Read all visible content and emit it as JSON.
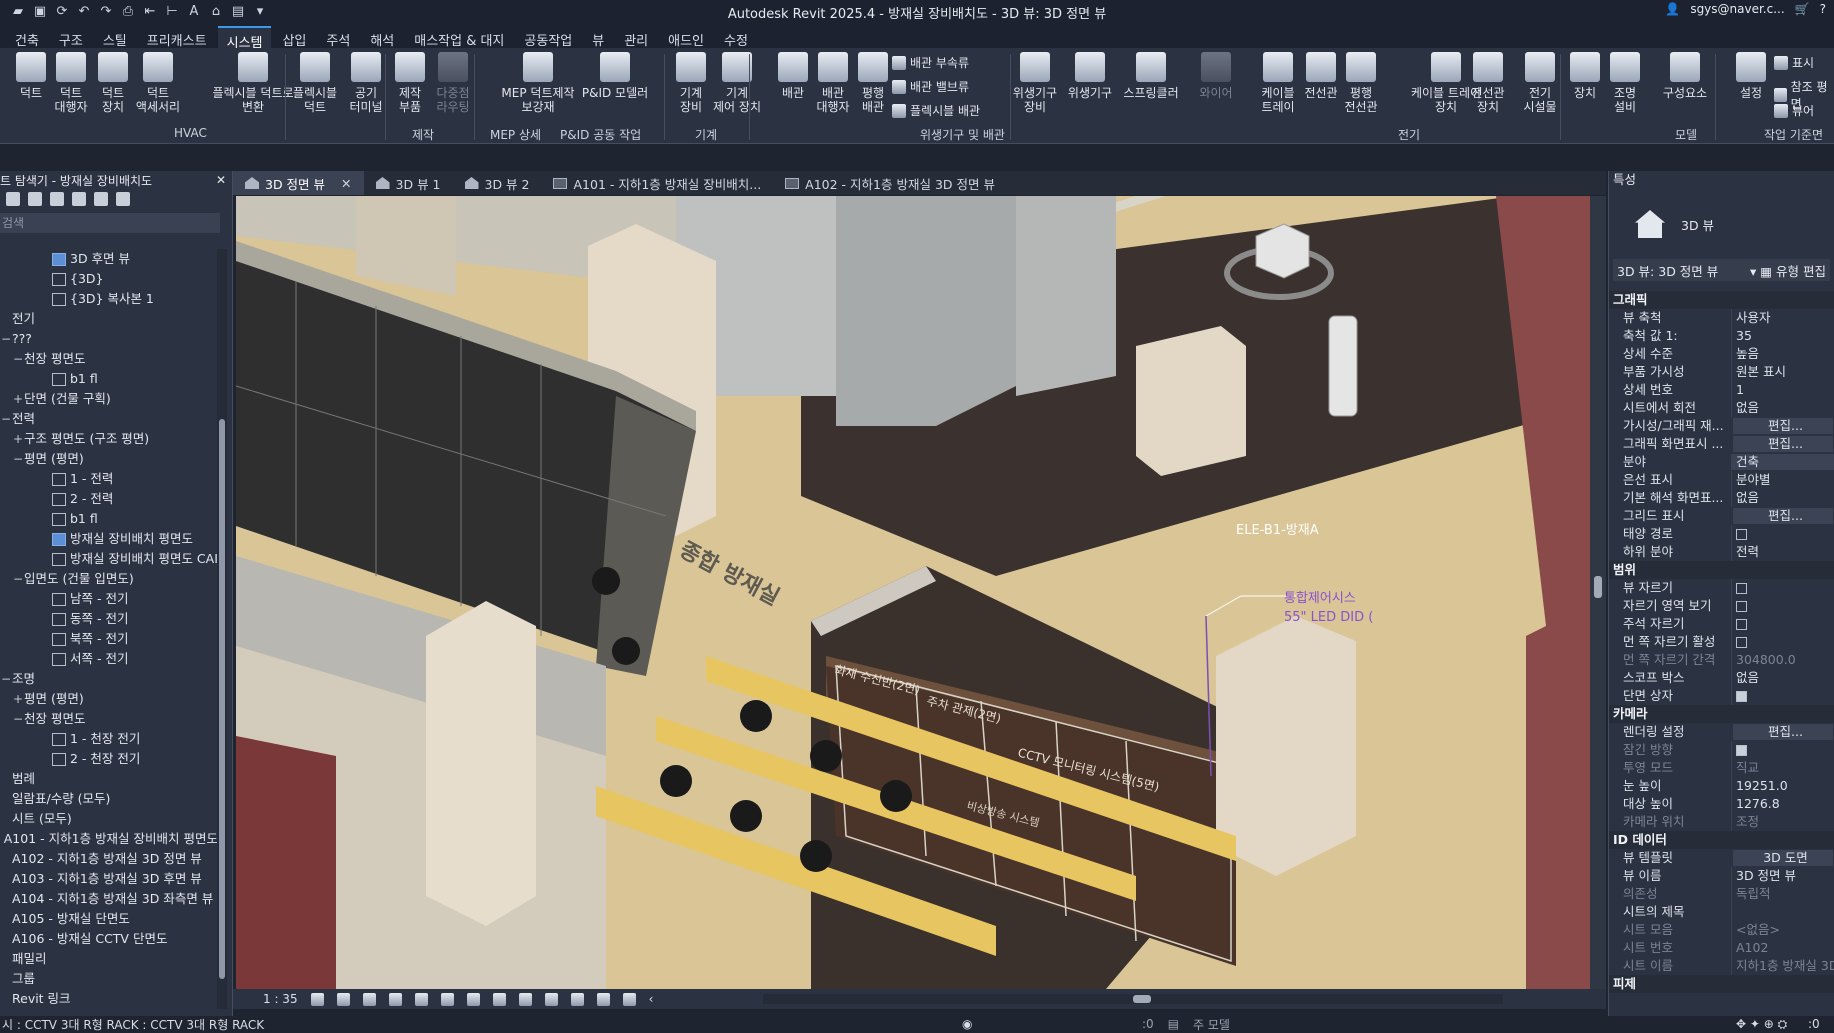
{
  "app": {
    "title": "Autodesk Revit 2025.4 - 방재실 장비배치도 - 3D 뷰: 3D 정면 뷰",
    "user": "sgys@naver.c..."
  },
  "ribbon_tabs": [
    "건축",
    "구조",
    "스틸",
    "프리캐스트",
    "시스템",
    "삽입",
    "주석",
    "해석",
    "매스작업 & 대지",
    "공동작업",
    "뷰",
    "관리",
    "애드인",
    "수정"
  ],
  "active_ribbon_tab": "시스템",
  "ribbon": {
    "buttons": [
      {
        "label": "덕트"
      },
      {
        "label": "덕트\n대행자"
      },
      {
        "label": "덕트\n장치"
      },
      {
        "label": "덕트\n액세서리"
      },
      {
        "label": "플렉시블 덕트로\n변환"
      },
      {
        "label": "플렉시블\n덕트"
      },
      {
        "label": "공기\n터미널"
      },
      {
        "label": "제작\n부품"
      },
      {
        "label": "다중점\n라우팅"
      },
      {
        "label": "MEP 덕트제작\n보강재"
      },
      {
        "label": "P&ID 모델러"
      },
      {
        "label": "기계\n장비"
      },
      {
        "label": "기계\n제어 장치"
      },
      {
        "label": "배관"
      },
      {
        "label": "배관\n대행자"
      },
      {
        "label": "평행\n배관"
      },
      {
        "label": "위생기구\n장비"
      },
      {
        "label": "위생기구"
      },
      {
        "label": "스프링클러"
      },
      {
        "label": "와이어"
      },
      {
        "label": "케이블\n트레이"
      },
      {
        "label": "전선관"
      },
      {
        "label": "평행\n전선관"
      },
      {
        "label": "케이블 트레이\n장치"
      },
      {
        "label": "전선관\n장치"
      },
      {
        "label": "전기\n시설물"
      },
      {
        "label": "장치"
      },
      {
        "label": "조명\n설비"
      },
      {
        "label": "구성요소"
      },
      {
        "label": "설정"
      }
    ],
    "small": {
      "pipe_fitting": "배관 부속류",
      "pipe_accessory": "배관 밸브류",
      "flex_pipe": "플렉시블 배관",
      "show": "표시",
      "ref_plane": "참조 평면",
      "viewer": "뷰어"
    },
    "panels": [
      "HVAC",
      "제작",
      "MEP 상세",
      "P&ID 공동 작업",
      "기계",
      "위생기구 및 배관",
      "전기",
      "모델",
      "작업 기준면"
    ]
  },
  "browser": {
    "title": "트 탐색기 - 방재실 장비배치도",
    "search_placeholder": "검색",
    "items": [
      {
        "indent": 40,
        "ex": "",
        "icon": "sel",
        "label": "3D 후면 뷰"
      },
      {
        "indent": 40,
        "ex": "",
        "icon": "view",
        "label": "{3D}"
      },
      {
        "indent": 40,
        "ex": "",
        "icon": "view",
        "label": "{3D} 복사본 1"
      },
      {
        "indent": 0,
        "ex": "",
        "icon": "",
        "label": "전기"
      },
      {
        "indent": 0,
        "ex": "−",
        "icon": "",
        "label": "???"
      },
      {
        "indent": 12,
        "ex": "−",
        "icon": "",
        "label": "천장 평면도"
      },
      {
        "indent": 40,
        "ex": "",
        "icon": "view",
        "label": "b1 fl"
      },
      {
        "indent": 12,
        "ex": "+",
        "icon": "",
        "label": "단면 (건물 구획)"
      },
      {
        "indent": 0,
        "ex": "−",
        "icon": "",
        "label": "전력"
      },
      {
        "indent": 12,
        "ex": "+",
        "icon": "",
        "label": "구조 평면도 (구조 평면)"
      },
      {
        "indent": 12,
        "ex": "−",
        "icon": "",
        "label": "평면 (평면)"
      },
      {
        "indent": 40,
        "ex": "",
        "icon": "view",
        "label": "1 - 전력"
      },
      {
        "indent": 40,
        "ex": "",
        "icon": "view",
        "label": "2 - 전력"
      },
      {
        "indent": 40,
        "ex": "",
        "icon": "view",
        "label": "b1 fl"
      },
      {
        "indent": 40,
        "ex": "",
        "icon": "sel",
        "label": "방재실 장비배치 평면도"
      },
      {
        "indent": 40,
        "ex": "",
        "icon": "view",
        "label": "방재실 장비배치 평면도 CAI"
      },
      {
        "indent": 12,
        "ex": "−",
        "icon": "",
        "label": "입면도 (건물 입면도)"
      },
      {
        "indent": 40,
        "ex": "",
        "icon": "view",
        "label": "남쪽 - 전기"
      },
      {
        "indent": 40,
        "ex": "",
        "icon": "view",
        "label": "동쪽 - 전기"
      },
      {
        "indent": 40,
        "ex": "",
        "icon": "view",
        "label": "북쪽 - 전기"
      },
      {
        "indent": 40,
        "ex": "",
        "icon": "view",
        "label": "서쪽 - 전기"
      },
      {
        "indent": 0,
        "ex": "−",
        "icon": "",
        "label": "조명"
      },
      {
        "indent": 12,
        "ex": "+",
        "icon": "",
        "label": "평면 (평면)"
      },
      {
        "indent": 12,
        "ex": "−",
        "icon": "",
        "label": "천장 평면도"
      },
      {
        "indent": 40,
        "ex": "",
        "icon": "view",
        "label": "1 - 천장 전기"
      },
      {
        "indent": 40,
        "ex": "",
        "icon": "view",
        "label": "2 - 천장 전기"
      },
      {
        "indent": 0,
        "ex": "",
        "icon": "",
        "label": "범례"
      },
      {
        "indent": 0,
        "ex": "",
        "icon": "",
        "label": "일람표/수량 (모두)"
      },
      {
        "indent": 0,
        "ex": "",
        "icon": "",
        "label": "시트 (모두)"
      },
      {
        "indent": 0,
        "ex": "",
        "icon": "",
        "label": "A101 - 지하1층 방재실 장비배치 평면도"
      },
      {
        "indent": 0,
        "ex": "",
        "icon": "",
        "label": "A102 - 지하1층 방재실 3D 정면 뷰"
      },
      {
        "indent": 0,
        "ex": "",
        "icon": "",
        "label": "A103 - 지하1층 방재실 3D 후면 뷰"
      },
      {
        "indent": 0,
        "ex": "",
        "icon": "",
        "label": "A104 - 지하1층 방재실 3D 좌측면 뷰"
      },
      {
        "indent": 0,
        "ex": "",
        "icon": "",
        "label": "A105 - 방재실 단면도"
      },
      {
        "indent": 0,
        "ex": "",
        "icon": "",
        "label": "A106 - 방재실 CCTV 단면도"
      },
      {
        "indent": 0,
        "ex": "",
        "icon": "",
        "label": "패밀리"
      },
      {
        "indent": 0,
        "ex": "",
        "icon": "",
        "label": "그룹"
      },
      {
        "indent": 0,
        "ex": "",
        "icon": "",
        "label": "Revit 링크"
      }
    ]
  },
  "view_tabs": [
    {
      "label": "3D 정면 뷰",
      "kind": "3d",
      "active": true
    },
    {
      "label": "3D 뷰 1",
      "kind": "3d",
      "active": false
    },
    {
      "label": "3D 뷰 2",
      "kind": "3d",
      "active": false
    },
    {
      "label": "A101 - 지하1층 방재실 장비배치...",
      "kind": "sheet",
      "active": false
    },
    {
      "label": "A102 - 지하1층 방재실 3D 정면 뷰",
      "kind": "sheet",
      "active": false
    }
  ],
  "viewport": {
    "tag_label": "ELE-B1-방재A",
    "tag_purple_1": "통합제어시스",
    "tag_purple_2": "55\" LED DID (",
    "floor_text": "종합 방재실",
    "wall_text_1": "화재 수신반(2면)",
    "wall_text_2": "주차 관제(2면)",
    "wall_text_3": "CCTV 모니터링 시스템(5면)",
    "wall_text_4": "비상방송 시스템"
  },
  "viewbar": {
    "scale": "1 : 35"
  },
  "properties": {
    "title": "특성",
    "type_name": "3D 뷰",
    "instance_selector": "3D 뷰: 3D 정면 뷰",
    "edit_type": "유형 편집",
    "groups": [
      {
        "name": "그래픽",
        "rows": [
          {
            "k": "뷰 축척",
            "v": "사용자"
          },
          {
            "k": "축척 값    1:",
            "v": "35"
          },
          {
            "k": "상세 수준",
            "v": "높음"
          },
          {
            "k": "부품 가시성",
            "v": "원본 표시"
          },
          {
            "k": "상세 번호",
            "v": "1"
          },
          {
            "k": "시트에서 회전",
            "v": "없음"
          },
          {
            "k": "가시성/그래픽 재...",
            "v": "편집...",
            "btn": true
          },
          {
            "k": "그래픽 화면표시 ...",
            "v": "편집...",
            "btn": true
          },
          {
            "k": "분야",
            "v": "건축",
            "field": true
          },
          {
            "k": "은선 표시",
            "v": "분야별"
          },
          {
            "k": "기본 해석 화면표...",
            "v": "없음"
          },
          {
            "k": "그리드 표시",
            "v": "편집...",
            "btn": true
          },
          {
            "k": "태양 경로",
            "v": "",
            "chk": "off"
          },
          {
            "k": "하위 분야",
            "v": "전력"
          }
        ]
      },
      {
        "name": "범위",
        "rows": [
          {
            "k": "뷰 자르기",
            "v": "",
            "chk": "off"
          },
          {
            "k": "자르기 영역 보기",
            "v": "",
            "chk": "off"
          },
          {
            "k": "주석 자르기",
            "v": "",
            "chk": "off"
          },
          {
            "k": "먼 쪽 자르기 활성",
            "v": "",
            "chk": "off"
          },
          {
            "k": "먼 쪽 자르기 간격",
            "v": "304800.0",
            "dim": true
          },
          {
            "k": "스코프 박스",
            "v": "없음"
          },
          {
            "k": "단면 상자",
            "v": "",
            "chk": "on"
          }
        ]
      },
      {
        "name": "카메라",
        "rows": [
          {
            "k": "렌더링 설정",
            "v": "편집...",
            "btn": true
          },
          {
            "k": "잠긴 방향",
            "v": "",
            "chk": "on",
            "dim": true
          },
          {
            "k": "투영 모드",
            "v": "직교",
            "dim": true
          },
          {
            "k": "눈 높이",
            "v": "19251.0"
          },
          {
            "k": "대상 높이",
            "v": "1276.8"
          },
          {
            "k": "카메라 위치",
            "v": "조정",
            "dim": true
          }
        ]
      },
      {
        "name": "ID 데이터",
        "rows": [
          {
            "k": "뷰 템플릿",
            "v": "3D 도면",
            "btn": true
          },
          {
            "k": "뷰 이름",
            "v": "3D 정면 뷰"
          },
          {
            "k": "의존성",
            "v": "독립적",
            "dim": true
          },
          {
            "k": "시트의 제목",
            "v": ""
          },
          {
            "k": "시트 모음",
            "v": "<없음>",
            "dim": true
          },
          {
            "k": "시트 번호",
            "v": "A102",
            "dim": true
          },
          {
            "k": "시트 이름",
            "v": "지하1층 방재실 3D",
            "dim": true
          }
        ]
      }
    ],
    "footer": "피제"
  },
  "status": {
    "text": "시 : CCTV 3대 R형 RACK : CCTV 3대 R형 RACK",
    "zero1": ":0",
    "main_model": "주 모델",
    "zero2": ":0"
  }
}
